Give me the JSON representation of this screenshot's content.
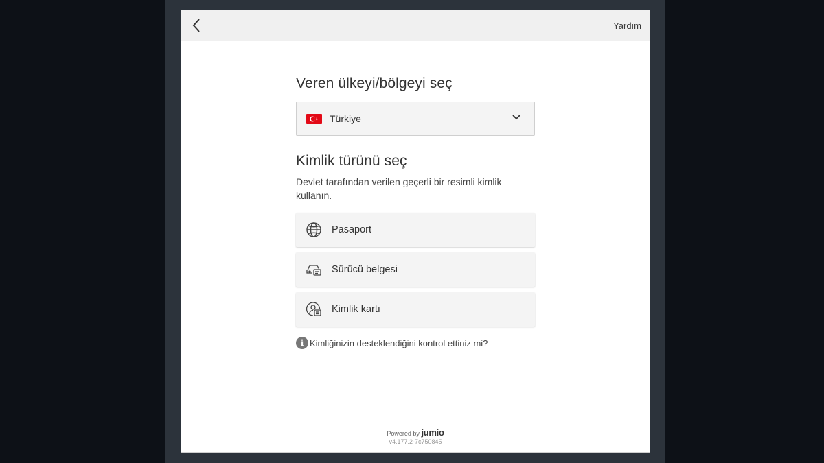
{
  "topbar": {
    "help_label": "Yardım"
  },
  "country_section": {
    "title": "Veren ülkeyi/bölgeyi seç",
    "selected_country": "Türkiye",
    "flag_colors": {
      "red": "#e30a17",
      "white": "#ffffff"
    }
  },
  "id_section": {
    "title": "Kimlik türünü seç",
    "description": "Devlet tarafından verilen geçerli bir resimli kimlik kullanın.",
    "options": [
      {
        "label": "Pasaport",
        "icon": "globe-icon"
      },
      {
        "label": "Sürücü belgesi",
        "icon": "car-card-icon"
      },
      {
        "label": "Kimlik kartı",
        "icon": "person-card-icon"
      }
    ],
    "support_check": "Kimliğinizin desteklendiğini kontrol ettiniz mi?"
  },
  "footer": {
    "powered_by": "Powered by",
    "brand": "jumio",
    "version": "v4.177.2-7c750845"
  }
}
